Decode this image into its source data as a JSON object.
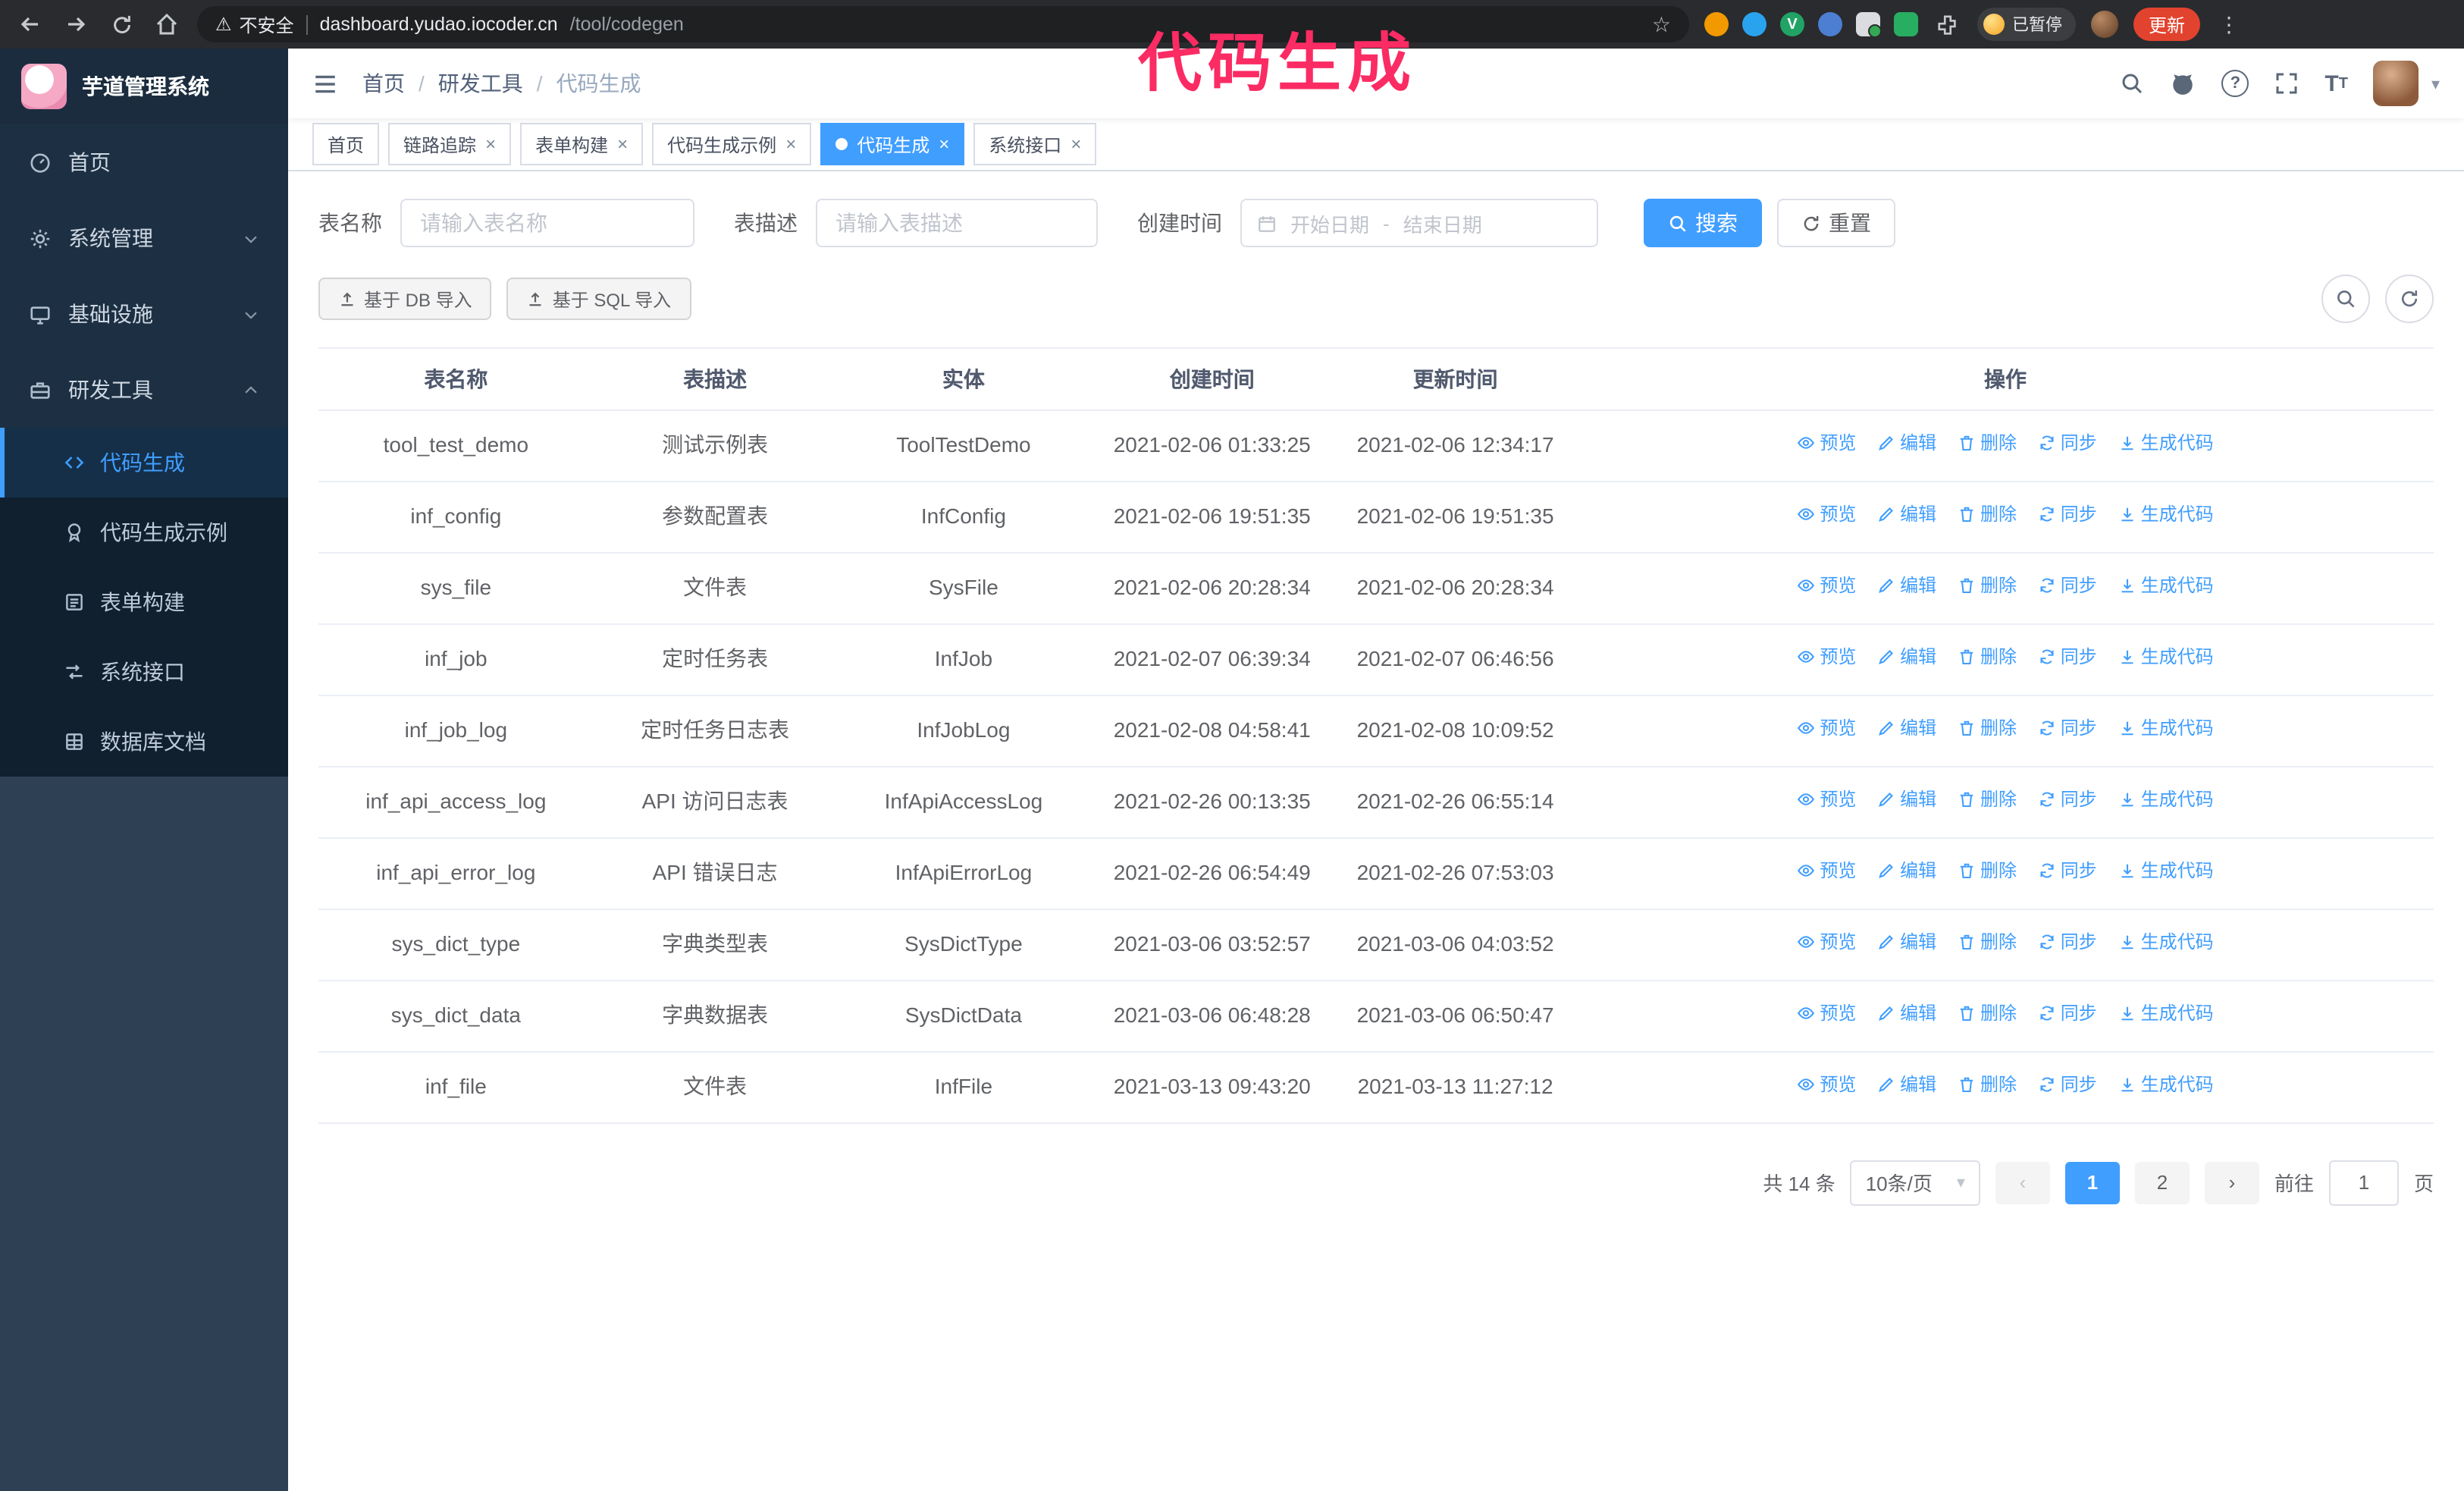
{
  "annotation": {
    "text": "代码生成",
    "color": "#fb2b63"
  },
  "colors": {
    "accent": "#409eff",
    "update_red": "#e2432e",
    "sidebar_dark": "#1d3043"
  },
  "icons": {
    "warning": "⚠",
    "star": "☆",
    "overflow": "⋮",
    "close": "×",
    "caret": "▾",
    "prev": "‹",
    "next": "›",
    "breadcrumb_sep": "/",
    "question": "?",
    "v_badge": "V"
  },
  "browser": {
    "security_label": "不安全",
    "url_host": "dashboard.yudao.iocoder.cn",
    "url_path": "/tool/codegen",
    "paused_badge": "已暂停",
    "update_button": "更新"
  },
  "sidebar": {
    "logo_title": "芋道管理系统",
    "items": [
      {
        "label": "首页"
      },
      {
        "label": "系统管理"
      },
      {
        "label": "基础设施"
      },
      {
        "label": "研发工具"
      }
    ],
    "submenu": [
      {
        "label": "代码生成"
      },
      {
        "label": "代码生成示例"
      },
      {
        "label": "表单构建"
      },
      {
        "label": "系统接口"
      },
      {
        "label": "数据库文档"
      }
    ]
  },
  "header": {
    "breadcrumb": [
      "首页",
      "研发工具",
      "代码生成"
    ]
  },
  "tabs": [
    {
      "label": "首页"
    },
    {
      "label": "链路追踪"
    },
    {
      "label": "表单构建"
    },
    {
      "label": "代码生成示例"
    },
    {
      "label": "代码生成"
    },
    {
      "label": "系统接口"
    }
  ],
  "filters": {
    "table_name_label": "表名称",
    "table_name_placeholder": "请输入表名称",
    "table_desc_label": "表描述",
    "table_desc_placeholder": "请输入表描述",
    "create_time_label": "创建时间",
    "start_date_placeholder": "开始日期",
    "range_separator": "-",
    "end_date_placeholder": "结束日期",
    "search_button": "搜索",
    "reset_button": "重置"
  },
  "toolbar": {
    "import_db": "基于 DB 导入",
    "import_sql": "基于 SQL 导入"
  },
  "table": {
    "columns": [
      "表名称",
      "表描述",
      "实体",
      "创建时间",
      "更新时间",
      "操作"
    ],
    "ops": {
      "preview": "预览",
      "edit": "编辑",
      "delete": "删除",
      "sync": "同步",
      "generate": "生成代码"
    },
    "rows": [
      {
        "name": "tool_test_demo",
        "desc": "测试示例表",
        "entity": "ToolTestDemo",
        "created": "2021-02-06 01:33:25",
        "updated": "2021-02-06 12:34:17"
      },
      {
        "name": "inf_config",
        "desc": "参数配置表",
        "entity": "InfConfig",
        "created": "2021-02-06 19:51:35",
        "updated": "2021-02-06 19:51:35"
      },
      {
        "name": "sys_file",
        "desc": "文件表",
        "entity": "SysFile",
        "created": "2021-02-06 20:28:34",
        "updated": "2021-02-06 20:28:34"
      },
      {
        "name": "inf_job",
        "desc": "定时任务表",
        "entity": "InfJob",
        "created": "2021-02-07 06:39:34",
        "updated": "2021-02-07 06:46:56"
      },
      {
        "name": "inf_job_log",
        "desc": "定时任务日志表",
        "entity": "InfJobLog",
        "created": "2021-02-08 04:58:41",
        "updated": "2021-02-08 10:09:52"
      },
      {
        "name": "inf_api_access_log",
        "desc": "API 访问日志表",
        "entity": "InfApiAccessLog",
        "created": "2021-02-26 00:13:35",
        "updated": "2021-02-26 06:55:14"
      },
      {
        "name": "inf_api_error_log",
        "desc": "API 错误日志",
        "entity": "InfApiErrorLog",
        "created": "2021-02-26 06:54:49",
        "updated": "2021-02-26 07:53:03"
      },
      {
        "name": "sys_dict_type",
        "desc": "字典类型表",
        "entity": "SysDictType",
        "created": "2021-03-06 03:52:57",
        "updated": "2021-03-06 04:03:52"
      },
      {
        "name": "sys_dict_data",
        "desc": "字典数据表",
        "entity": "SysDictData",
        "created": "2021-03-06 06:48:28",
        "updated": "2021-03-06 06:50:47"
      },
      {
        "name": "inf_file",
        "desc": "文件表",
        "entity": "InfFile",
        "created": "2021-03-13 09:43:20",
        "updated": "2021-03-13 11:27:12"
      }
    ]
  },
  "pagination": {
    "total": "共 14 条",
    "page_size": "10条/页",
    "pages": [
      "1",
      "2"
    ],
    "goto_prefix": "前往",
    "goto_value": "1",
    "goto_suffix": "页"
  }
}
